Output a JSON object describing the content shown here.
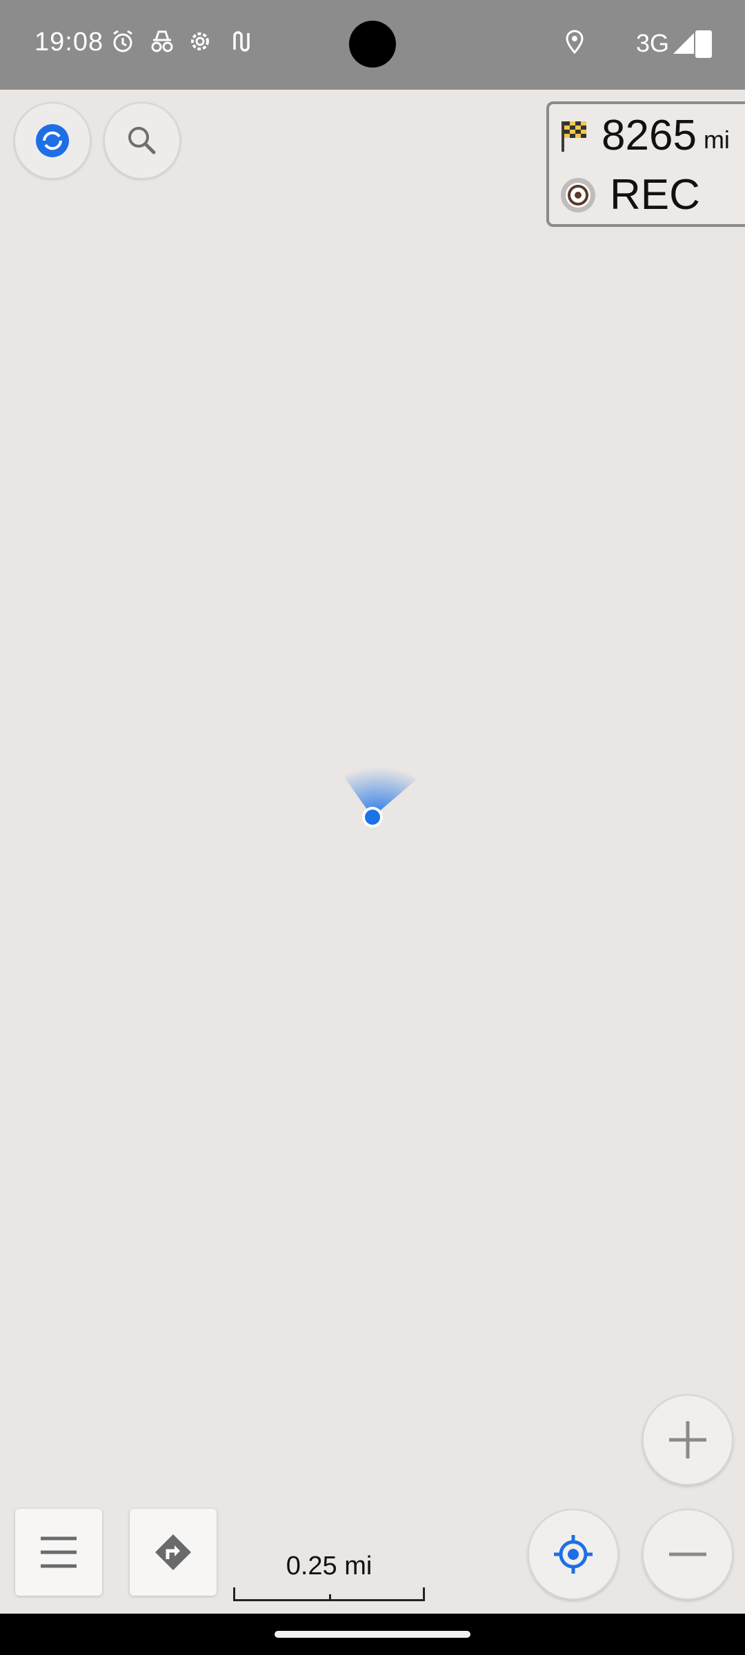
{
  "status_bar": {
    "time": "19:08",
    "network": "3G",
    "icons": [
      "alarm-icon",
      "incognito-icon",
      "settings-gear-icon",
      "route-icon",
      "location-icon",
      "signal-icon",
      "battery-charging-icon"
    ]
  },
  "map": {
    "info_panel": {
      "distance_value": "8265",
      "distance_unit": "mi",
      "distance_icon": "checkered-flag-icon",
      "rec_label": "REC",
      "rec_icon": "record-target-icon"
    },
    "scale_label": "0.25 mi",
    "accent_color": "#1e6fe6",
    "location_marker_color": "#1a73e8"
  }
}
